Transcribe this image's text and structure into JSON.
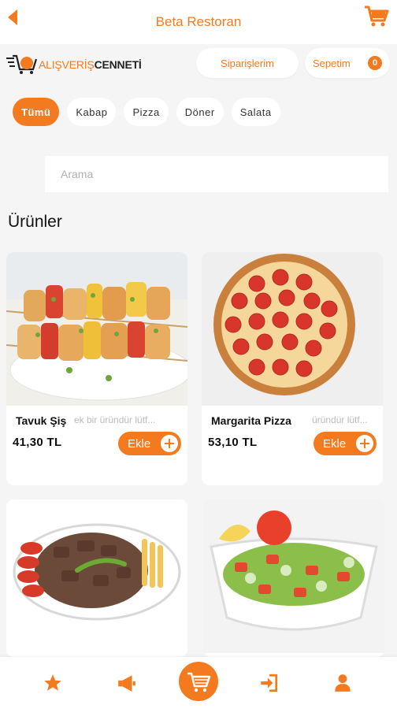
{
  "header": {
    "title": "Beta Restoran",
    "back_icon": "back-arrow-icon",
    "cart_icon": "shopping-cart-icon"
  },
  "brand": {
    "logo_part1": "ALIŞVERİŞ",
    "logo_part2": "CENNETİ"
  },
  "actions": {
    "orders_label": "Siparişlerim",
    "basket_label": "Sepetim",
    "basket_count": "0"
  },
  "categories": [
    {
      "label": "Tümü",
      "active": true
    },
    {
      "label": "Kabap",
      "active": false
    },
    {
      "label": "Pizza",
      "active": false
    },
    {
      "label": "Döner",
      "active": false
    },
    {
      "label": "Salata",
      "active": false
    }
  ],
  "search": {
    "placeholder": "Arama"
  },
  "section_title": "Ürünler",
  "products": [
    {
      "name": "Tavuk Şiş",
      "desc": "ek bir üründür lütf...",
      "price": "41,30 TL",
      "add_label": "Ekle"
    },
    {
      "name": "Margarita Pizza",
      "desc": "üründür lütf...",
      "price": "53,10 TL",
      "add_label": "Ekle"
    },
    {
      "name": "",
      "desc": "",
      "price": "",
      "add_label": ""
    },
    {
      "name": "",
      "desc": "",
      "price": "",
      "add_label": ""
    }
  ],
  "bottom_nav": [
    {
      "icon": "star-icon"
    },
    {
      "icon": "megaphone-icon"
    },
    {
      "icon": "shopping-cart-icon"
    },
    {
      "icon": "login-icon"
    },
    {
      "icon": "user-icon"
    }
  ],
  "colors": {
    "accent": "#f47a20",
    "background": "#f5f5f5"
  }
}
